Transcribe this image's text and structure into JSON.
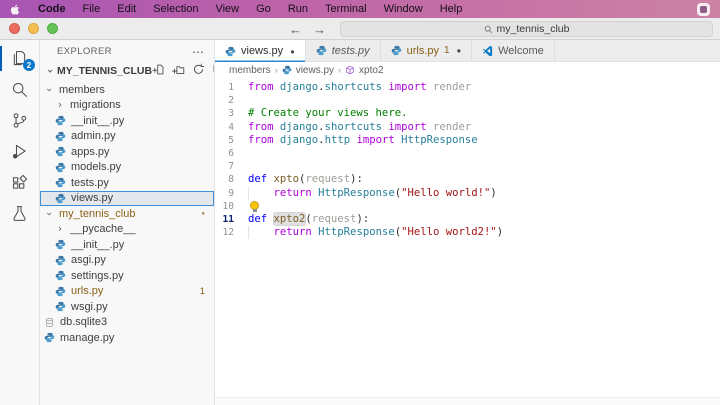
{
  "menu_bar": {
    "items": [
      "Code",
      "File",
      "Edit",
      "Selection",
      "View",
      "Go",
      "Run",
      "Terminal",
      "Window",
      "Help"
    ],
    "right_icon": "shield-icon"
  },
  "title_bar": {
    "back_glyph": "←",
    "forward_glyph": "→",
    "search_value": "my_tennis_club"
  },
  "activity_bar": {
    "items": [
      {
        "icon": "files-icon",
        "active": true,
        "badge": "2"
      },
      {
        "icon": "search-icon"
      },
      {
        "icon": "source-control-icon"
      },
      {
        "icon": "debug-icon"
      },
      {
        "icon": "extensions-icon"
      },
      {
        "icon": "beaker-icon"
      }
    ]
  },
  "explorer": {
    "title": "EXPLORER",
    "more_glyph": "⋯",
    "section_label": "MY_TENNIS_CLUB",
    "section_actions": [
      "new-file-icon",
      "new-folder-icon",
      "refresh-icon",
      "collapse-all-icon"
    ],
    "tree": [
      {
        "label": "members",
        "kind": "folder",
        "expanded": true,
        "level": 0
      },
      {
        "label": "migrations",
        "kind": "folder",
        "expanded": false,
        "level": 1
      },
      {
        "label": "__init__.py",
        "kind": "python",
        "level": 1
      },
      {
        "label": "admin.py",
        "kind": "python",
        "level": 1
      },
      {
        "label": "apps.py",
        "kind": "python",
        "level": 1
      },
      {
        "label": "models.py",
        "kind": "python",
        "level": 1
      },
      {
        "label": "tests.py",
        "kind": "python",
        "level": 1
      },
      {
        "label": "views.py",
        "kind": "python",
        "level": 1,
        "selected": true
      },
      {
        "label": "my_tennis_club",
        "kind": "folder",
        "expanded": true,
        "level": 0,
        "modified": true,
        "badge": "●",
        "badge_dot": true
      },
      {
        "label": "__pycache__",
        "kind": "folder",
        "expanded": false,
        "level": 1
      },
      {
        "label": "__init__.py",
        "kind": "python",
        "level": 1
      },
      {
        "label": "asgi.py",
        "kind": "python",
        "level": 1
      },
      {
        "label": "settings.py",
        "kind": "python",
        "level": 1
      },
      {
        "label": "urls.py",
        "kind": "python",
        "level": 1,
        "modified": true,
        "badge": "1"
      },
      {
        "label": "wsgi.py",
        "kind": "python",
        "level": 1
      },
      {
        "label": "db.sqlite3",
        "kind": "database",
        "level": 0
      },
      {
        "label": "manage.py",
        "kind": "python",
        "level": 0
      }
    ]
  },
  "tabs": [
    {
      "label": "views.py",
      "icon": "python",
      "active": true,
      "dirty": true
    },
    {
      "label": "tests.py",
      "icon": "python",
      "italic": true
    },
    {
      "label": "urls.py",
      "icon": "python",
      "modified": true,
      "badge": "1",
      "dirty": true
    },
    {
      "label": "Welcome",
      "icon": "vscode"
    }
  ],
  "breadcrumb": [
    {
      "label": "members"
    },
    {
      "label": "views.py",
      "icon": "python"
    },
    {
      "label": "xpto2",
      "icon": "method"
    }
  ],
  "editor": {
    "lines": [
      {
        "n": 1,
        "tokens": [
          [
            "from ",
            "k"
          ],
          [
            "django",
            "n"
          ],
          [
            ".",
            "p"
          ],
          [
            "shortcuts",
            "n"
          ],
          [
            " ",
            "p"
          ],
          [
            "import ",
            "k"
          ],
          [
            "render",
            "u"
          ]
        ]
      },
      {
        "n": 2,
        "tokens": []
      },
      {
        "n": 3,
        "tokens": [
          [
            "# Create your views here.",
            "c"
          ]
        ]
      },
      {
        "n": 4,
        "tokens": [
          [
            "from ",
            "k"
          ],
          [
            "django",
            "n"
          ],
          [
            ".",
            "p"
          ],
          [
            "shortcuts",
            "n"
          ],
          [
            " ",
            "p"
          ],
          [
            "import ",
            "k"
          ],
          [
            "render",
            "u"
          ]
        ]
      },
      {
        "n": 5,
        "tokens": [
          [
            "from ",
            "k"
          ],
          [
            "django",
            "n"
          ],
          [
            ".",
            "p"
          ],
          [
            "http",
            "n"
          ],
          [
            " ",
            "p"
          ],
          [
            "import ",
            "k"
          ],
          [
            "HttpResponse",
            "n"
          ]
        ]
      },
      {
        "n": 6,
        "tokens": []
      },
      {
        "n": 7,
        "tokens": []
      },
      {
        "n": 8,
        "tokens": [
          [
            "def ",
            "d"
          ],
          [
            "xpto",
            "f"
          ],
          [
            "(",
            "p"
          ],
          [
            "request",
            "u"
          ],
          [
            "):",
            "p"
          ]
        ]
      },
      {
        "n": 9,
        "guide": true,
        "tokens": [
          [
            "    ",
            "p"
          ],
          [
            "return ",
            "k"
          ],
          [
            "HttpResponse",
            "n"
          ],
          [
            "(",
            "p"
          ],
          [
            "\"Hello world!\"",
            "s"
          ],
          [
            ")",
            "p"
          ]
        ]
      },
      {
        "n": 10,
        "bulb": true,
        "tokens": []
      },
      {
        "n": 11,
        "active": true,
        "tokens": [
          [
            "def ",
            "d"
          ],
          [
            "xpto2",
            "f hl"
          ],
          [
            "(",
            "p"
          ],
          [
            "request",
            "u"
          ],
          [
            "):",
            "p"
          ]
        ]
      },
      {
        "n": 12,
        "guide": true,
        "tokens": [
          [
            "    ",
            "p"
          ],
          [
            "return ",
            "k"
          ],
          [
            "HttpResponse",
            "n"
          ],
          [
            "(",
            "p"
          ],
          [
            "\"Hello world2!\"",
            "s"
          ],
          [
            ")",
            "p"
          ]
        ]
      }
    ]
  },
  "colors": {
    "accent_blue": "#0d79cc",
    "active_tab_underline": "#2a86d3",
    "git_modified": "#8a6116",
    "keyword": "#af00db",
    "definition": "#0000ff",
    "namespace": "#267f99",
    "function_name": "#795e26",
    "string": "#a31515",
    "comment": "#008000",
    "menubar_pink": "#bf63a8"
  }
}
